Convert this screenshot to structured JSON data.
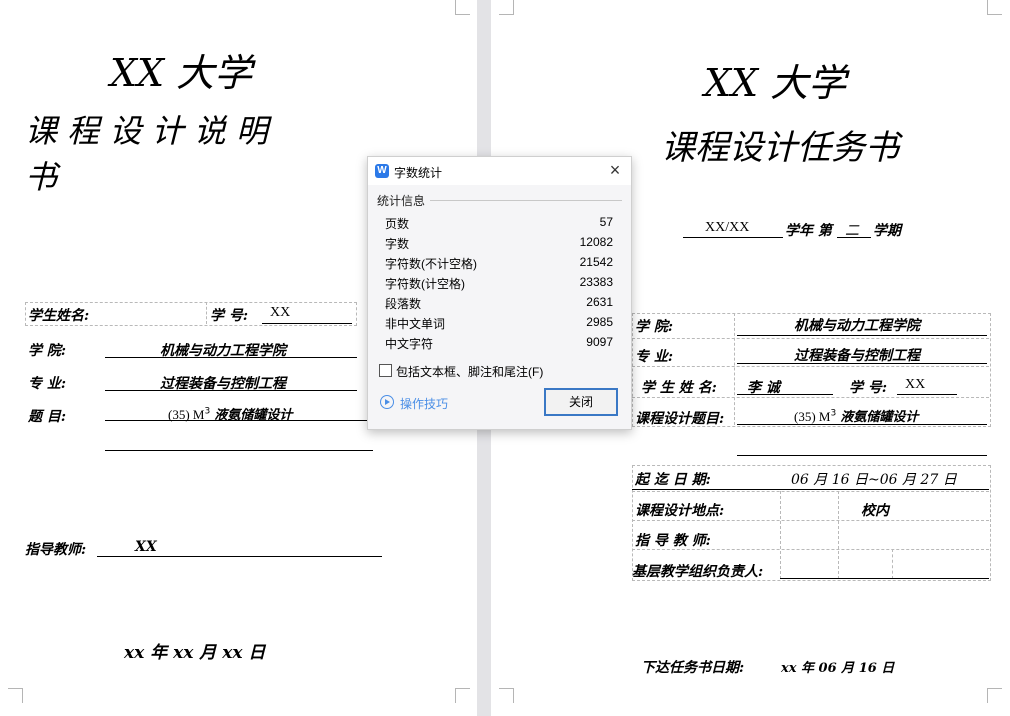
{
  "left_page": {
    "university": "XX 大学",
    "doc_title_line1": "课 程 设 计 说 明",
    "doc_title_line2": "书",
    "student_name_label": "学生姓名:",
    "student_id_label": "学 号:",
    "student_id_value": "XX",
    "college_label": "学    院:",
    "college_value": "机械与动力工程学院",
    "major_label": "专    业:",
    "major_value": "过程装备与控制工程",
    "topic_label": "题    目:",
    "topic_value": "(35) M",
    "topic_sup": "3",
    "topic_suffix": "液氨储罐设计",
    "advisor_label": "指导教师:",
    "advisor_value": "XX",
    "date_text": "xx 年 xx 月 xx 日"
  },
  "right_page": {
    "university": "XX 大学",
    "doc_title": "课程设计任务书",
    "term_year": "XX/XX",
    "term_text_a": "学年 第",
    "term_number": "二",
    "term_text_b": "学期",
    "college_label": "学          院:",
    "college_value": "机械与动力工程学院",
    "major_label": "专          业:",
    "major_value": "过程装备与控制工程",
    "student_name_label": "学 生 姓 名:",
    "student_name_value": "李    诚",
    "student_id_label": "学 号:",
    "student_id_value": "XX",
    "topic_label": "课程设计题目:",
    "topic_value": "(35) M",
    "topic_sup": "3",
    "topic_suffix": "液氨储罐设计",
    "start_label": "起 迄 日 期:",
    "start_value": "06 月 16 日~06 月 27 日",
    "place_label": "课程设计地点:",
    "place_value": "校内",
    "advisor_label": "指 导 教 师:",
    "leader_label": "基层教学组织负责人:",
    "issue_label": "下达任务书日期:",
    "issue_value": "xx 年 06 月 16 日"
  },
  "dialog": {
    "title": "字数统计",
    "section_title": "统计信息",
    "stats": [
      {
        "label": "页数",
        "value": "57"
      },
      {
        "label": "字数",
        "value": "12082"
      },
      {
        "label": "字符数(不计空格)",
        "value": "21542"
      },
      {
        "label": "字符数(计空格)",
        "value": "23383"
      },
      {
        "label": "段落数",
        "value": "2631"
      },
      {
        "label": "非中文单词",
        "value": "2985"
      },
      {
        "label": "中文字符",
        "value": "9097"
      }
    ],
    "checkbox_label": "包括文本框、脚注和尾注(F)",
    "checkbox_checked": false,
    "tips_label": "操作技巧",
    "close_button_label": "关闭",
    "close_icon": "close-icon",
    "app_icon": "wps-writer-icon",
    "accent_color": "#2b79e8"
  }
}
